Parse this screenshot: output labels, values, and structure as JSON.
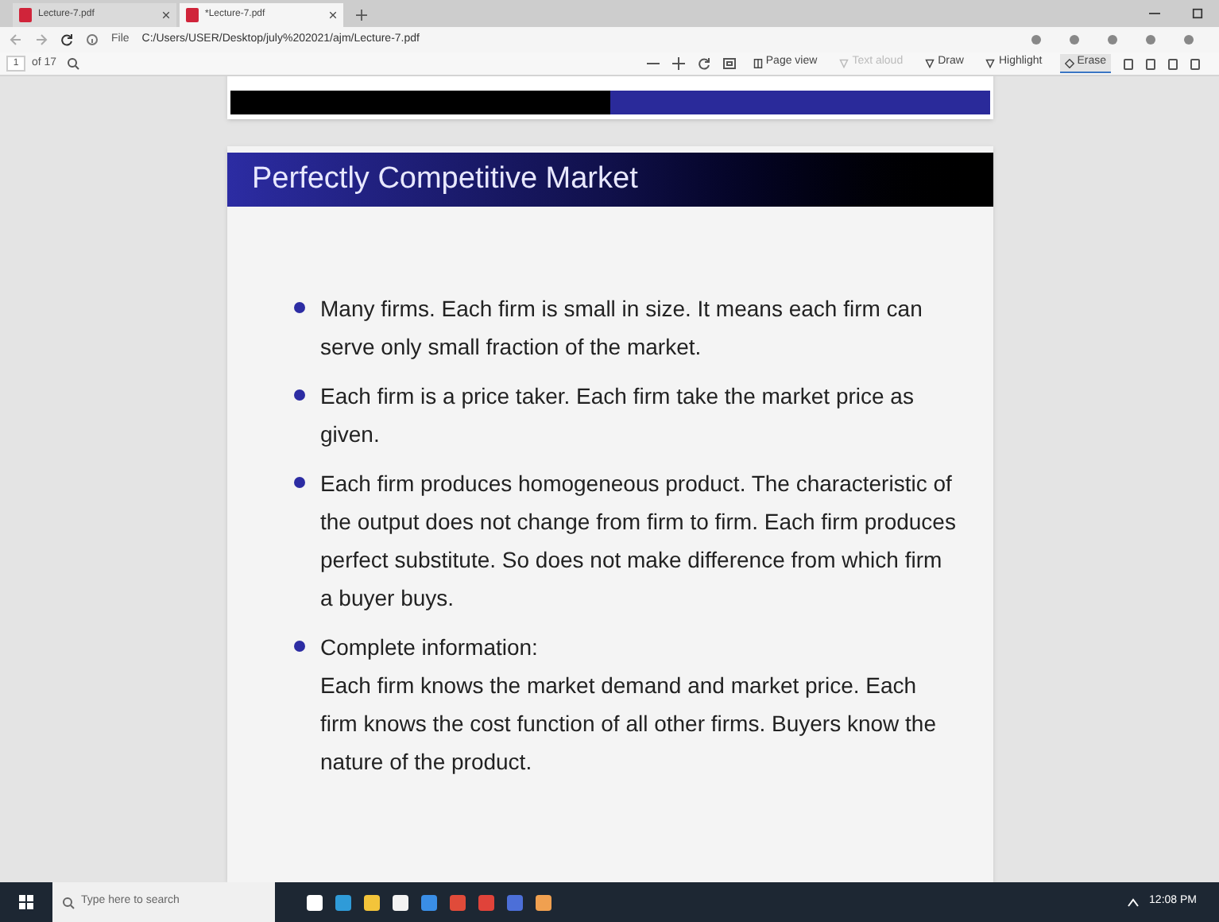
{
  "tabs": [
    {
      "title": "Lecture-7.pdf",
      "selected": false
    },
    {
      "title": "*Lecture-7.pdf",
      "selected": true
    }
  ],
  "address": {
    "scheme": "File",
    "url": "C:/Users/USER/Desktop/july%202021/ajm/Lecture-7.pdf"
  },
  "pdf_toolbar": {
    "page": "1",
    "page_count": "of 17",
    "tools": [
      {
        "label": "Page view",
        "disabled": false,
        "selected": false,
        "kind": "page"
      },
      {
        "label": "Text aloud",
        "disabled": true,
        "selected": false,
        "kind": "aloud"
      },
      {
        "label": "Draw",
        "disabled": false,
        "selected": false,
        "kind": "draw"
      },
      {
        "label": "Highlight",
        "disabled": false,
        "selected": false,
        "kind": "highlight"
      },
      {
        "label": "Erase",
        "disabled": false,
        "selected": true,
        "kind": "erase"
      }
    ]
  },
  "slide": {
    "title": "Perfectly Competitive Market",
    "bullets": [
      "Many firms. Each firm is small in size. It means each firm can serve only small fraction of the market.",
      "Each firm is a price taker. Each firm take the market price as given.",
      "Each firm produces homogeneous product. The characteristic of the output does not change from firm to firm. Each firm produces perfect substitute. So does not make difference from which firm a buyer buys.",
      "Complete information:\nEach firm knows the market demand and market price. Each firm knows the cost function of all other firms. Buyers know the nature of the product."
    ]
  },
  "taskbar": {
    "search_placeholder": "Type here to search",
    "time": "12:08 PM"
  }
}
